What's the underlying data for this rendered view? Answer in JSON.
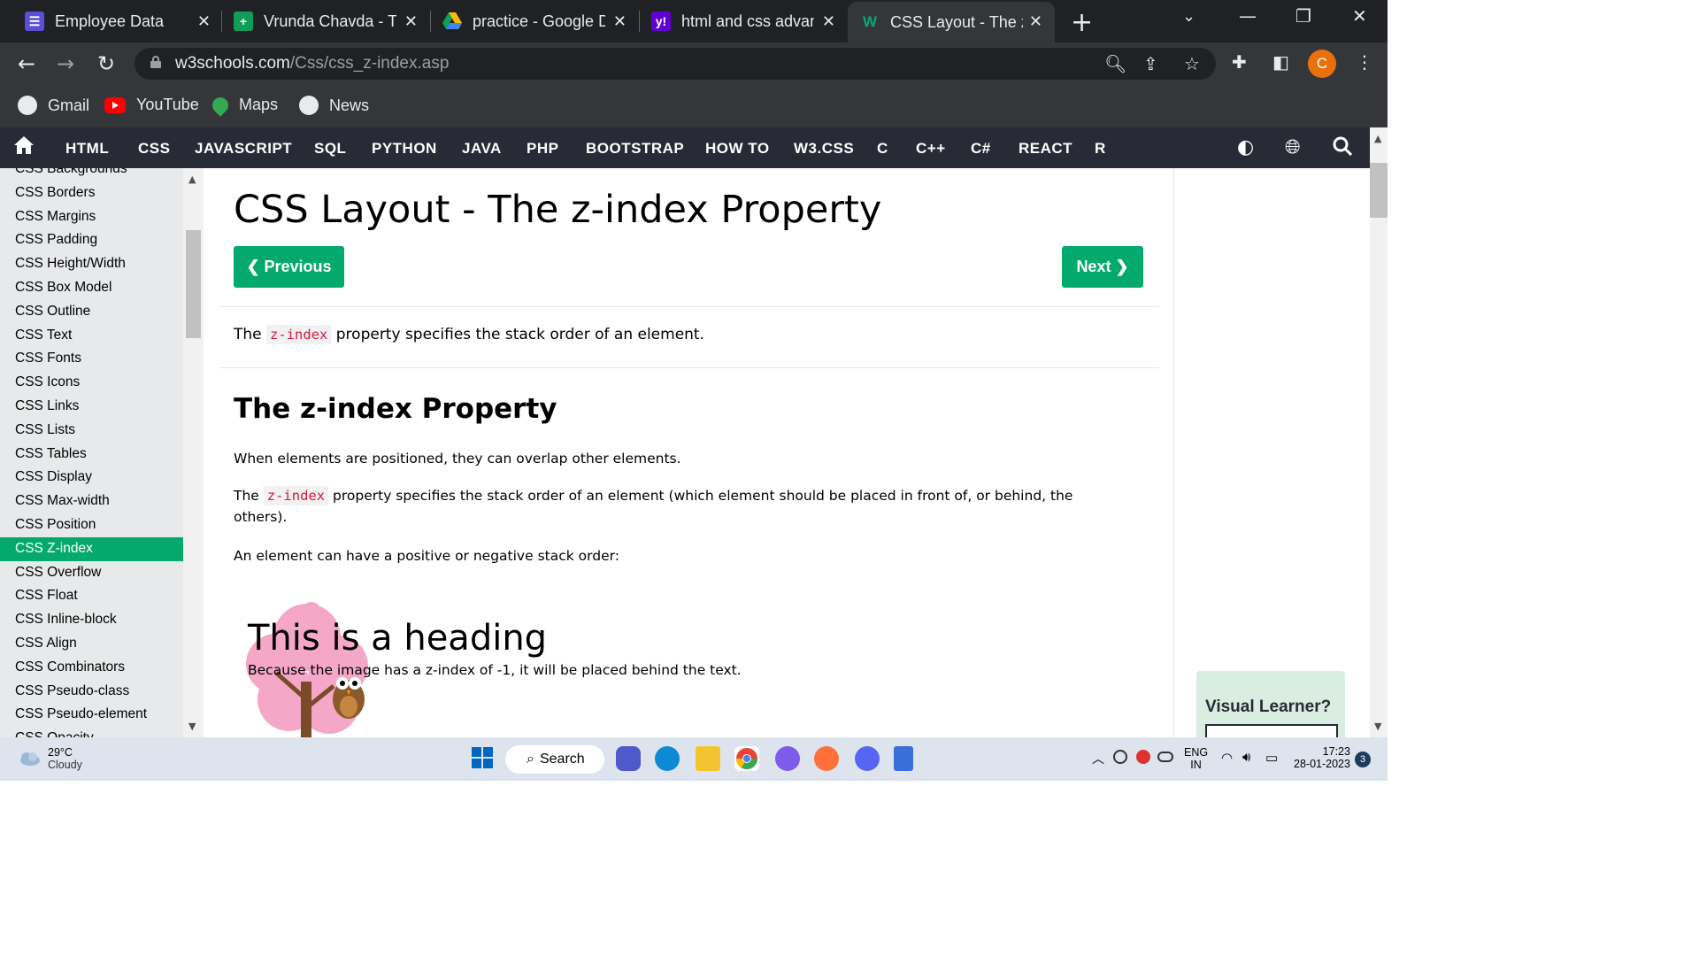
{
  "browser": {
    "tabs": [
      {
        "title": "Employee Data",
        "icon": "list-icon",
        "color": "#5b4fd6"
      },
      {
        "title": "Vrunda Chavda - Ta",
        "icon": "plus-sheet-icon",
        "color": "#0f9d58"
      },
      {
        "title": "practice - Google D",
        "icon": "google-drive-icon",
        "color": "#fbbc04"
      },
      {
        "title": "html and css advanc",
        "icon": "yahoo-icon",
        "color": "#6001d2"
      },
      {
        "title": "CSS Layout - The z-",
        "icon": "w3schools-icon",
        "color": "#04aa6d",
        "active": true
      }
    ],
    "url_host": "w3schools.com",
    "url_path": "/Css/css_z-index.asp",
    "profile_initial": "C",
    "bookmarks": [
      "Gmail",
      "YouTube",
      "Maps",
      "News"
    ]
  },
  "w3nav": {
    "items": [
      "HTML",
      "CSS",
      "JAVASCRIPT",
      "SQL",
      "PYTHON",
      "JAVA",
      "PHP",
      "BOOTSTRAP",
      "HOW TO",
      "W3.CSS",
      "C",
      "C++",
      "C#",
      "REACT",
      "R"
    ]
  },
  "sidebar": {
    "items": [
      "CSS Backgrounds",
      "CSS Borders",
      "CSS Margins",
      "CSS Padding",
      "CSS Height/Width",
      "CSS Box Model",
      "CSS Outline",
      "CSS Text",
      "CSS Fonts",
      "CSS Icons",
      "CSS Links",
      "CSS Lists",
      "CSS Tables",
      "CSS Display",
      "CSS Max-width",
      "CSS Position",
      "CSS Z-index",
      "CSS Overflow",
      "CSS Float",
      "CSS Inline-block",
      "CSS Align",
      "CSS Combinators",
      "CSS Pseudo-class",
      "CSS Pseudo-element",
      "CSS Opacity"
    ],
    "active": "CSS Z-index"
  },
  "main": {
    "title": "CSS Layout - The z-index Property",
    "prev_label": "❮ Previous",
    "next_label": "Next ❯",
    "intro_before": "The ",
    "intro_code": "z-index",
    "intro_after": " property specifies the stack order of an element.",
    "h2": "The z-index Property",
    "p1": "When elements are positioned, they can overlap other elements.",
    "p2_before": "The ",
    "p2_code": "z-index",
    "p2_after": " property specifies the stack order of an element (which element should be placed in front of, or behind, the others).",
    "p3": "An element can have a positive or negative stack order:",
    "demo_heading": "This is a heading",
    "demo_text": "Because the image has a z-index of -1, it will be placed behind the text."
  },
  "ad": {
    "title": "Visual Learner?"
  },
  "taskbar": {
    "temp": "29°C",
    "weather": "Cloudy",
    "search_label": "Search",
    "lang1": "ENG",
    "lang2": "IN",
    "time": "17:23",
    "date": "28-01-2023",
    "notifications": "3"
  }
}
